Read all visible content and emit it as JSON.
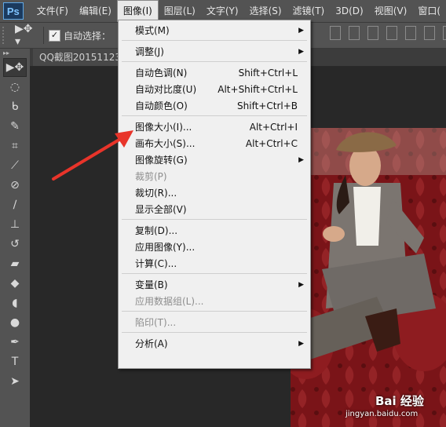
{
  "app": {
    "logo": "Ps"
  },
  "menubar": {
    "items": [
      "文件(F)",
      "编辑(E)",
      "图像(I)",
      "图层(L)",
      "文字(Y)",
      "选择(S)",
      "滤镜(T)",
      "3D(D)",
      "视图(V)",
      "窗口("
    ],
    "active_index": 2
  },
  "options_bar": {
    "auto_select_label": "自动选择：",
    "auto_select_checked": true
  },
  "document": {
    "tab_label": "QQ截图20151123"
  },
  "image_menu": {
    "items": [
      {
        "label": "模式(M)",
        "shortcut": "",
        "submenu": true,
        "disabled": false
      },
      {
        "separator": true
      },
      {
        "label": "调整(J)",
        "shortcut": "",
        "submenu": true,
        "disabled": false
      },
      {
        "separator": true
      },
      {
        "label": "自动色调(N)",
        "shortcut": "Shift+Ctrl+L",
        "submenu": false,
        "disabled": false
      },
      {
        "label": "自动对比度(U)",
        "shortcut": "Alt+Shift+Ctrl+L",
        "submenu": false,
        "disabled": false
      },
      {
        "label": "自动颜色(O)",
        "shortcut": "Shift+Ctrl+B",
        "submenu": false,
        "disabled": false
      },
      {
        "separator": true
      },
      {
        "label": "图像大小(I)...",
        "shortcut": "Alt+Ctrl+I",
        "submenu": false,
        "disabled": false
      },
      {
        "label": "画布大小(S)...",
        "shortcut": "Alt+Ctrl+C",
        "submenu": false,
        "disabled": false
      },
      {
        "label": "图像旋转(G)",
        "shortcut": "",
        "submenu": true,
        "disabled": false
      },
      {
        "label": "裁剪(P)",
        "shortcut": "",
        "submenu": false,
        "disabled": true
      },
      {
        "label": "裁切(R)...",
        "shortcut": "",
        "submenu": false,
        "disabled": false
      },
      {
        "label": "显示全部(V)",
        "shortcut": "",
        "submenu": false,
        "disabled": false
      },
      {
        "separator": true
      },
      {
        "label": "复制(D)...",
        "shortcut": "",
        "submenu": false,
        "disabled": false
      },
      {
        "label": "应用图像(Y)...",
        "shortcut": "",
        "submenu": false,
        "disabled": false
      },
      {
        "label": "计算(C)...",
        "shortcut": "",
        "submenu": false,
        "disabled": false
      },
      {
        "separator": true
      },
      {
        "label": "变量(B)",
        "shortcut": "",
        "submenu": true,
        "disabled": false
      },
      {
        "label": "应用数据组(L)...",
        "shortcut": "",
        "submenu": false,
        "disabled": true
      },
      {
        "separator": true
      },
      {
        "label": "陷印(T)...",
        "shortcut": "",
        "submenu": false,
        "disabled": true
      },
      {
        "separator": true
      },
      {
        "label": "分析(A)",
        "shortcut": "",
        "submenu": true,
        "disabled": false
      }
    ]
  },
  "tools": [
    "move-tool",
    "marquee-tool",
    "lasso-tool",
    "quick-select-tool",
    "crop-tool",
    "eyedropper-tool",
    "healing-brush-tool",
    "brush-tool",
    "clone-stamp-tool",
    "history-brush-tool",
    "eraser-tool",
    "paint-bucket-tool",
    "blur-tool",
    "dodge-tool",
    "pen-tool",
    "type-tool",
    "path-select-tool"
  ],
  "watermark": {
    "brand": "Bai 经验",
    "url": "jingyan.baidu.com"
  },
  "colors": {
    "panel": "#535353",
    "canvas": "#282828",
    "menu_bg": "#f0f0f0",
    "arrow": "#e8342a"
  }
}
